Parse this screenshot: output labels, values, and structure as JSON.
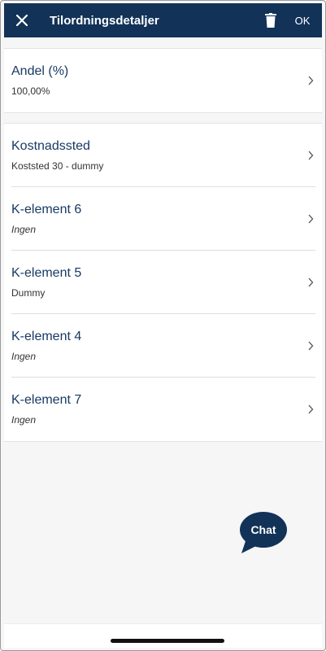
{
  "header": {
    "title": "Tilordningsdetaljer",
    "ok_label": "OK",
    "close_icon": "close-icon",
    "trash_icon": "trash-icon"
  },
  "sections": [
    {
      "rows": [
        {
          "label": "Andel (%)",
          "value": "100,00%",
          "italic": false
        }
      ]
    },
    {
      "rows": [
        {
          "label": "Kostnadssted",
          "value": "Koststed 30 - dummy",
          "italic": false
        },
        {
          "label": "K-element 6",
          "value": "Ingen",
          "italic": true
        },
        {
          "label": "K-element 5",
          "value": "Dummy",
          "italic": false
        },
        {
          "label": "K-element 4",
          "value": "Ingen",
          "italic": true
        },
        {
          "label": "K-element 7",
          "value": "Ingen",
          "italic": true
        }
      ]
    }
  ],
  "chat": {
    "label": "Chat"
  },
  "colors": {
    "header_bg": "#123258",
    "label_text": "#173a63",
    "chat_bg": "#123258"
  }
}
